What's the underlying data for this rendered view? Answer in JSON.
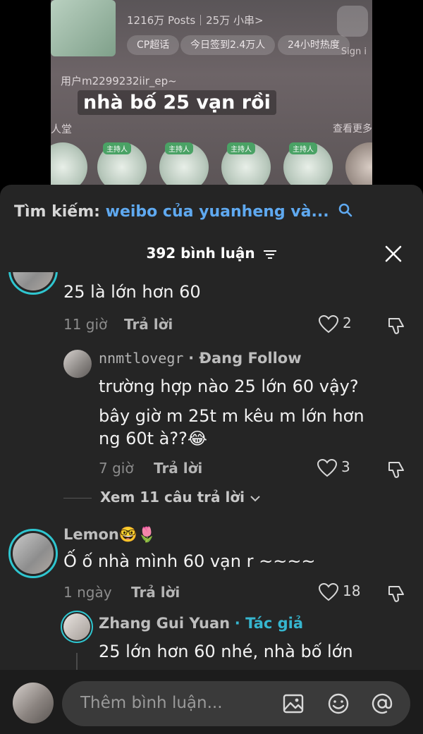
{
  "video": {
    "stats_text": "1216万 Posts｜25万 小串>",
    "pills": [
      "CP超话",
      "今日签到2.4万人",
      "24小时热度"
    ],
    "sign_label": "Sign i",
    "user_line": "用户m2299232iir_ep~",
    "caption": "nhà bố 25 vạn rồi",
    "hall_label": "人堂",
    "more_label": "查看更多",
    "host_tag": "主持人"
  },
  "search": {
    "label": "Tìm kiếm:",
    "query": "weibo của yuanheng và..."
  },
  "header": {
    "comment_count": "392 bình luận"
  },
  "comments": [
    {
      "text": "25 là lớn hơn 60",
      "time": "11 giờ",
      "reply_label": "Trả lời",
      "likes": "2",
      "replies": [
        {
          "username": "nnmtlovegr",
          "badge": "· Đang Follow",
          "lines": [
            "trường hợp nào 25 lớn 60 vậy?",
            "bây giờ m 25t m kêu m lớn hơn",
            "ng 60t à??😂"
          ],
          "time": "7 giờ",
          "reply_label": "Trả lời",
          "likes": "3"
        }
      ],
      "view_more": "Xem 11 câu trả lời"
    },
    {
      "username": "Lemon🤓🌷",
      "text": "Ố ố nhà mình 60 vạn r ~~~~",
      "time": "1 ngày",
      "reply_label": "Trả lời",
      "likes": "18",
      "replies": [
        {
          "username": "Zhang Gui Yuan",
          "badge": "· Tác giả",
          "lines": [
            "25 lớn hơn 60 nhé, nhà bố lớn"
          ]
        }
      ]
    }
  ],
  "composer": {
    "placeholder": "Thêm bình luận..."
  },
  "colors": {
    "accent": "#2fc6d0",
    "search_query": "#5fa9f0",
    "author_badge": "#36b6cf",
    "sheet_bg": "#252525"
  }
}
